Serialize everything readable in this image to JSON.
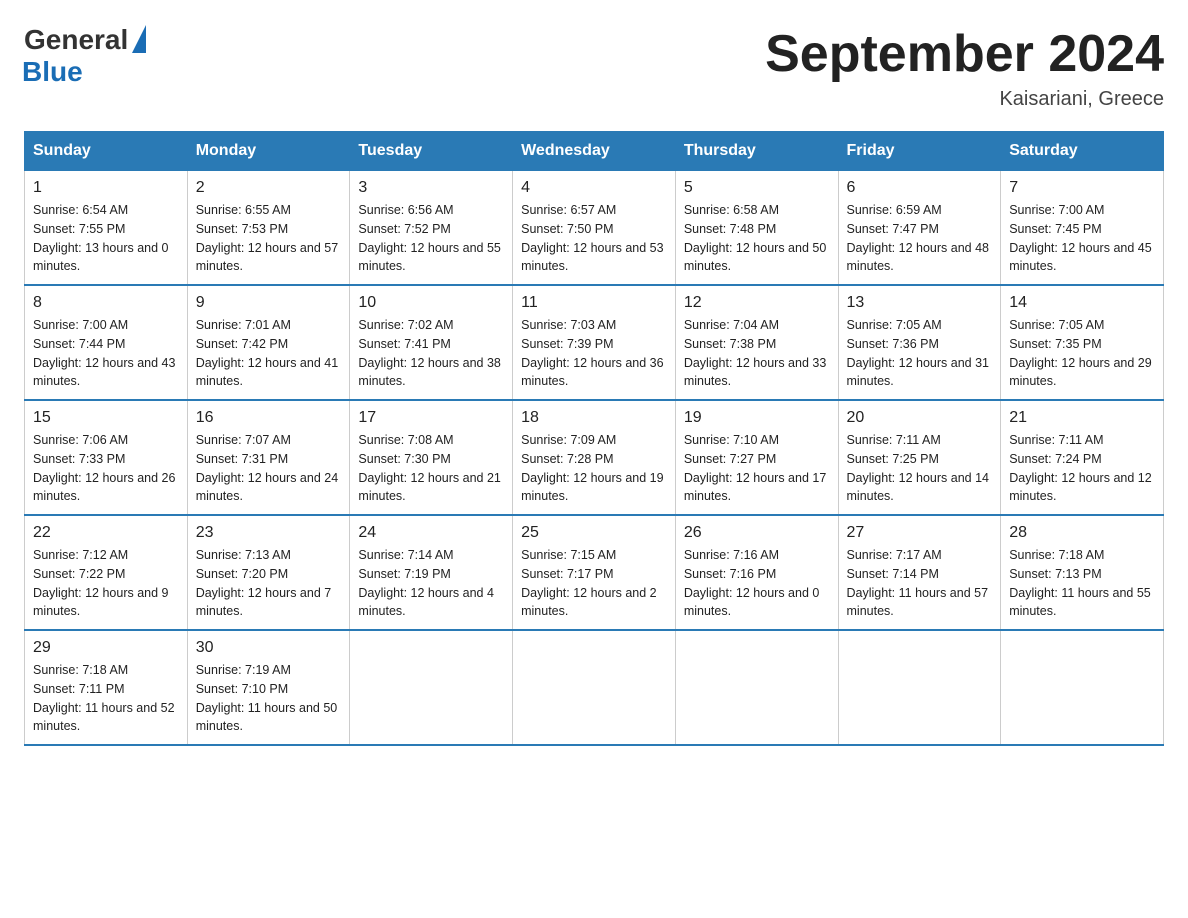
{
  "logo": {
    "general": "General",
    "blue": "Blue"
  },
  "title": "September 2024",
  "location": "Kaisariani, Greece",
  "days_header": [
    "Sunday",
    "Monday",
    "Tuesday",
    "Wednesday",
    "Thursday",
    "Friday",
    "Saturday"
  ],
  "weeks": [
    [
      {
        "day": "1",
        "sunrise": "6:54 AM",
        "sunset": "7:55 PM",
        "daylight": "13 hours and 0 minutes."
      },
      {
        "day": "2",
        "sunrise": "6:55 AM",
        "sunset": "7:53 PM",
        "daylight": "12 hours and 57 minutes."
      },
      {
        "day": "3",
        "sunrise": "6:56 AM",
        "sunset": "7:52 PM",
        "daylight": "12 hours and 55 minutes."
      },
      {
        "day": "4",
        "sunrise": "6:57 AM",
        "sunset": "7:50 PM",
        "daylight": "12 hours and 53 minutes."
      },
      {
        "day": "5",
        "sunrise": "6:58 AM",
        "sunset": "7:48 PM",
        "daylight": "12 hours and 50 minutes."
      },
      {
        "day": "6",
        "sunrise": "6:59 AM",
        "sunset": "7:47 PM",
        "daylight": "12 hours and 48 minutes."
      },
      {
        "day": "7",
        "sunrise": "7:00 AM",
        "sunset": "7:45 PM",
        "daylight": "12 hours and 45 minutes."
      }
    ],
    [
      {
        "day": "8",
        "sunrise": "7:00 AM",
        "sunset": "7:44 PM",
        "daylight": "12 hours and 43 minutes."
      },
      {
        "day": "9",
        "sunrise": "7:01 AM",
        "sunset": "7:42 PM",
        "daylight": "12 hours and 41 minutes."
      },
      {
        "day": "10",
        "sunrise": "7:02 AM",
        "sunset": "7:41 PM",
        "daylight": "12 hours and 38 minutes."
      },
      {
        "day": "11",
        "sunrise": "7:03 AM",
        "sunset": "7:39 PM",
        "daylight": "12 hours and 36 minutes."
      },
      {
        "day": "12",
        "sunrise": "7:04 AM",
        "sunset": "7:38 PM",
        "daylight": "12 hours and 33 minutes."
      },
      {
        "day": "13",
        "sunrise": "7:05 AM",
        "sunset": "7:36 PM",
        "daylight": "12 hours and 31 minutes."
      },
      {
        "day": "14",
        "sunrise": "7:05 AM",
        "sunset": "7:35 PM",
        "daylight": "12 hours and 29 minutes."
      }
    ],
    [
      {
        "day": "15",
        "sunrise": "7:06 AM",
        "sunset": "7:33 PM",
        "daylight": "12 hours and 26 minutes."
      },
      {
        "day": "16",
        "sunrise": "7:07 AM",
        "sunset": "7:31 PM",
        "daylight": "12 hours and 24 minutes."
      },
      {
        "day": "17",
        "sunrise": "7:08 AM",
        "sunset": "7:30 PM",
        "daylight": "12 hours and 21 minutes."
      },
      {
        "day": "18",
        "sunrise": "7:09 AM",
        "sunset": "7:28 PM",
        "daylight": "12 hours and 19 minutes."
      },
      {
        "day": "19",
        "sunrise": "7:10 AM",
        "sunset": "7:27 PM",
        "daylight": "12 hours and 17 minutes."
      },
      {
        "day": "20",
        "sunrise": "7:11 AM",
        "sunset": "7:25 PM",
        "daylight": "12 hours and 14 minutes."
      },
      {
        "day": "21",
        "sunrise": "7:11 AM",
        "sunset": "7:24 PM",
        "daylight": "12 hours and 12 minutes."
      }
    ],
    [
      {
        "day": "22",
        "sunrise": "7:12 AM",
        "sunset": "7:22 PM",
        "daylight": "12 hours and 9 minutes."
      },
      {
        "day": "23",
        "sunrise": "7:13 AM",
        "sunset": "7:20 PM",
        "daylight": "12 hours and 7 minutes."
      },
      {
        "day": "24",
        "sunrise": "7:14 AM",
        "sunset": "7:19 PM",
        "daylight": "12 hours and 4 minutes."
      },
      {
        "day": "25",
        "sunrise": "7:15 AM",
        "sunset": "7:17 PM",
        "daylight": "12 hours and 2 minutes."
      },
      {
        "day": "26",
        "sunrise": "7:16 AM",
        "sunset": "7:16 PM",
        "daylight": "12 hours and 0 minutes."
      },
      {
        "day": "27",
        "sunrise": "7:17 AM",
        "sunset": "7:14 PM",
        "daylight": "11 hours and 57 minutes."
      },
      {
        "day": "28",
        "sunrise": "7:18 AM",
        "sunset": "7:13 PM",
        "daylight": "11 hours and 55 minutes."
      }
    ],
    [
      {
        "day": "29",
        "sunrise": "7:18 AM",
        "sunset": "7:11 PM",
        "daylight": "11 hours and 52 minutes."
      },
      {
        "day": "30",
        "sunrise": "7:19 AM",
        "sunset": "7:10 PM",
        "daylight": "11 hours and 50 minutes."
      },
      null,
      null,
      null,
      null,
      null
    ]
  ]
}
